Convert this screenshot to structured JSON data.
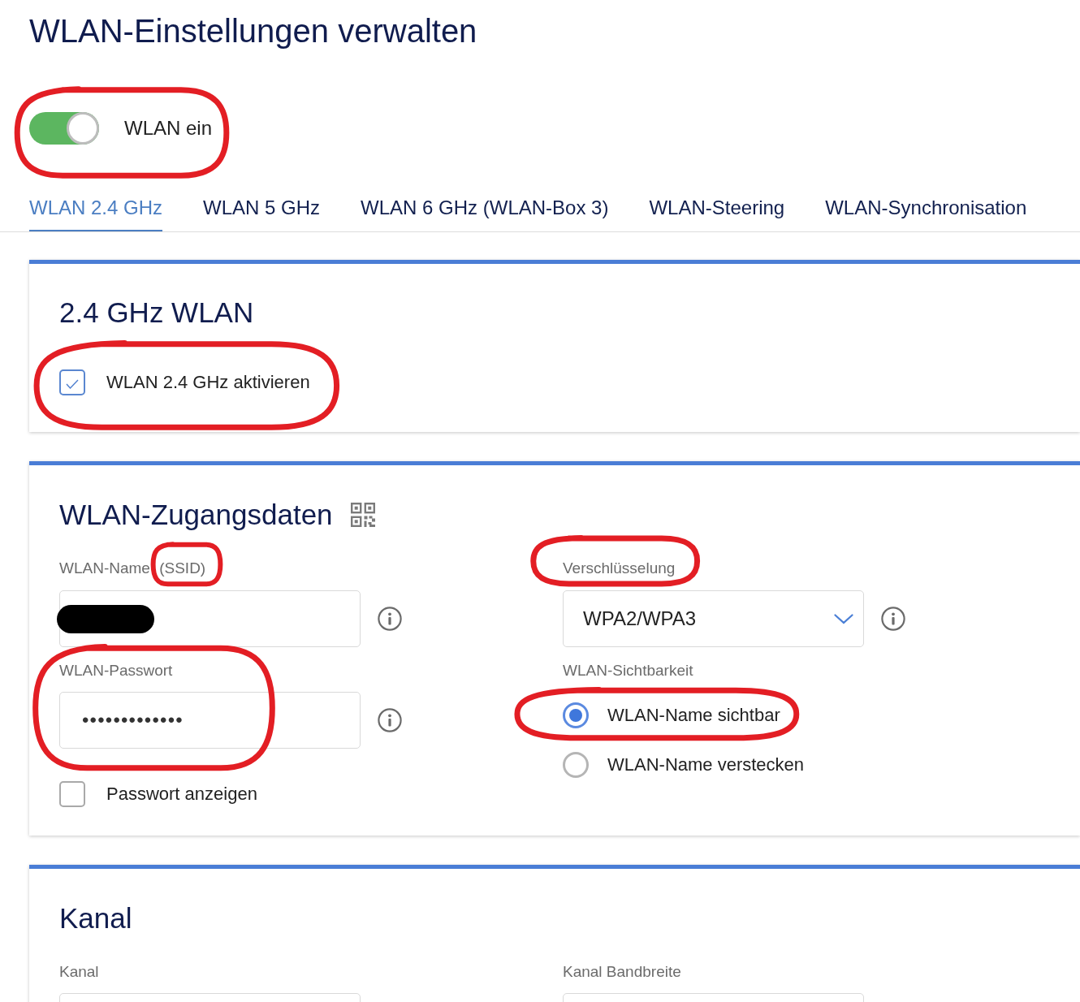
{
  "page": {
    "title": "WLAN-Einstellungen verwalten"
  },
  "wlan_toggle": {
    "label": "WLAN ein",
    "on": true,
    "circled": true
  },
  "tabs": [
    {
      "label": "WLAN 2.4 GHz",
      "selected": true
    },
    {
      "label": "WLAN 5 GHz",
      "selected": false
    },
    {
      "label": "WLAN 6 GHz (WLAN-Box 3)",
      "selected": false
    },
    {
      "label": "WLAN-Steering",
      "selected": false
    },
    {
      "label": "WLAN-Synchronisation",
      "selected": false
    }
  ],
  "band_section": {
    "title": "2.4 GHz WLAN",
    "enable": {
      "label": "WLAN 2.4 GHz aktivieren",
      "checked": true,
      "circled": true
    }
  },
  "credentials_section": {
    "title": "WLAN-Zugangsdaten",
    "ssid": {
      "label": "WLAN-Name (SSID)",
      "label_circled": true,
      "redacted": true
    },
    "password": {
      "label": "WLAN-Passwort",
      "value": "•••••••••••••",
      "circled": true
    },
    "show_password": {
      "label": "Passwort anzeigen",
      "checked": false
    },
    "encryption": {
      "label": "Verschlüsselung",
      "value": "WPA2/WPA3",
      "label_circled": true
    },
    "visibility": {
      "label": "WLAN-Sichtbarkeit",
      "options": [
        {
          "label": "WLAN-Name sichtbar",
          "selected": true,
          "circled": true
        },
        {
          "label": "WLAN-Name verstecken",
          "selected": false,
          "circled": false
        }
      ]
    }
  },
  "channel_section": {
    "title": "Kanal",
    "fields": [
      {
        "label": "Kanal"
      },
      {
        "label": "Kanal Bandbreite"
      }
    ]
  }
}
